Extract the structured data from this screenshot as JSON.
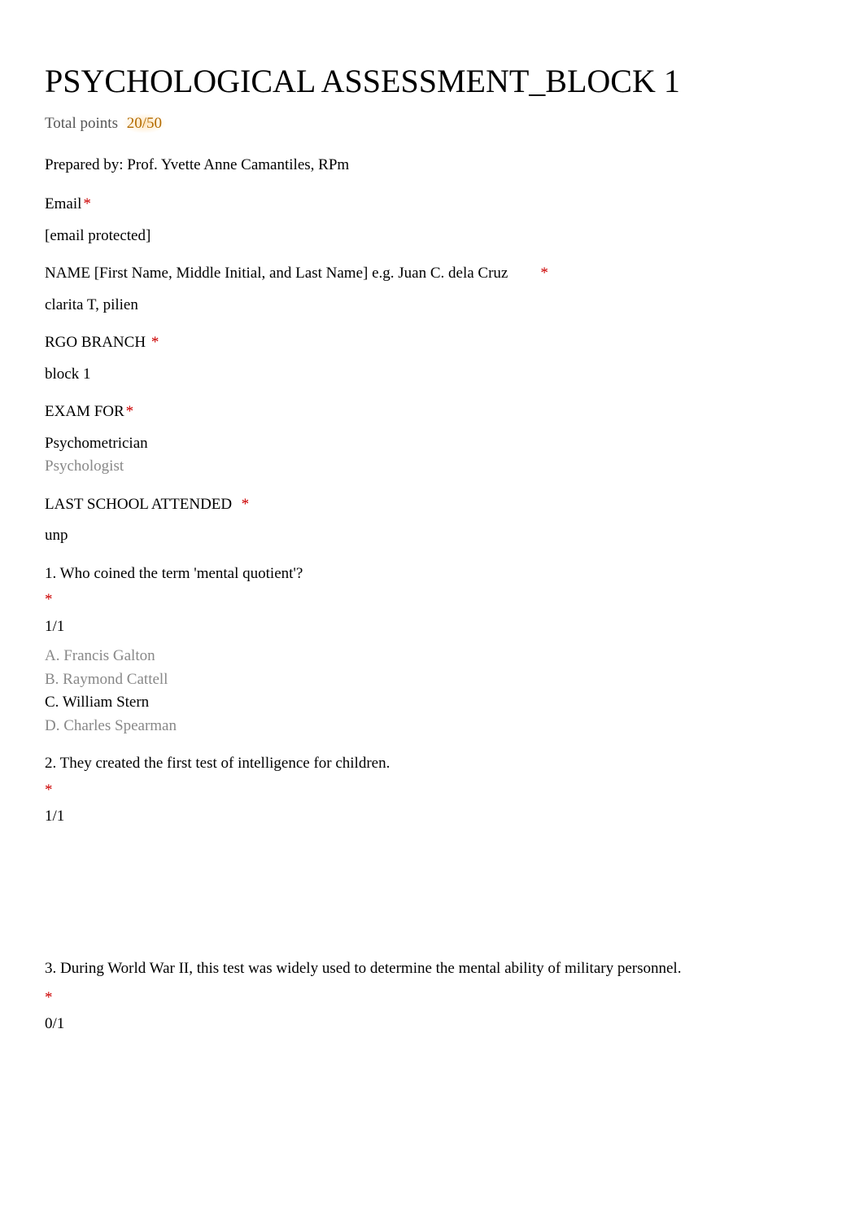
{
  "title": "PSYCHOLOGICAL ASSESSMENT_BLOCK 1",
  "points": {
    "label": "Total points",
    "value": "20/50"
  },
  "prepared": "Prepared by: Prof. Yvette Anne Camantiles, RPm",
  "email": {
    "label": "Email",
    "value": "[email protected]"
  },
  "name": {
    "label": "NAME [First Name, Middle Initial, and Last Name] e.g. Juan C. dela Cruz",
    "value": "clarita T, pilien"
  },
  "rgo": {
    "label": "RGO BRANCH",
    "value": "block 1"
  },
  "exam_for": {
    "label": "EXAM FOR",
    "options": [
      {
        "text": "Psychometrician",
        "selected": true
      },
      {
        "text": "Psychologist",
        "selected": false
      }
    ]
  },
  "school": {
    "label": "LAST SCHOOL ATTENDED",
    "value": "unp"
  },
  "q1": {
    "text": "1. Who coined the term 'mental quotient'?",
    "score": "1/1",
    "answers": [
      {
        "text": "A. Francis Galton",
        "correct": false
      },
      {
        "text": "B. Raymond Cattell",
        "correct": false
      },
      {
        "text": "C. William Stern",
        "correct": true
      },
      {
        "text": "D. Charles Spearman",
        "correct": false
      }
    ]
  },
  "q2": {
    "text": "2. They created the first test of intelligence for children.",
    "score": "1/1"
  },
  "q3": {
    "text": "3. During World War II, this test was widely used to determine the mental ability of military personnel.",
    "score": "0/1"
  }
}
